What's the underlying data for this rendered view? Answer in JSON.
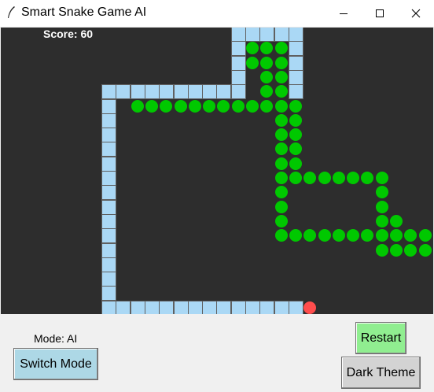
{
  "window": {
    "title": "Smart Snake Game AI"
  },
  "game": {
    "score_text": "Score: 60",
    "colors": {
      "background": "#2d2d2d",
      "wall": "#aad8f5",
      "snake": "#00c800",
      "food": "#ff4d4d"
    }
  },
  "controls": {
    "mode_text": "Mode: AI",
    "switch_mode_label": "Switch Mode",
    "restart_label": "Restart",
    "theme_label": "Dark Theme",
    "switch_mode_color": "#add8e6",
    "restart_color": "#90ee90",
    "theme_color": "#d3d3d3"
  }
}
